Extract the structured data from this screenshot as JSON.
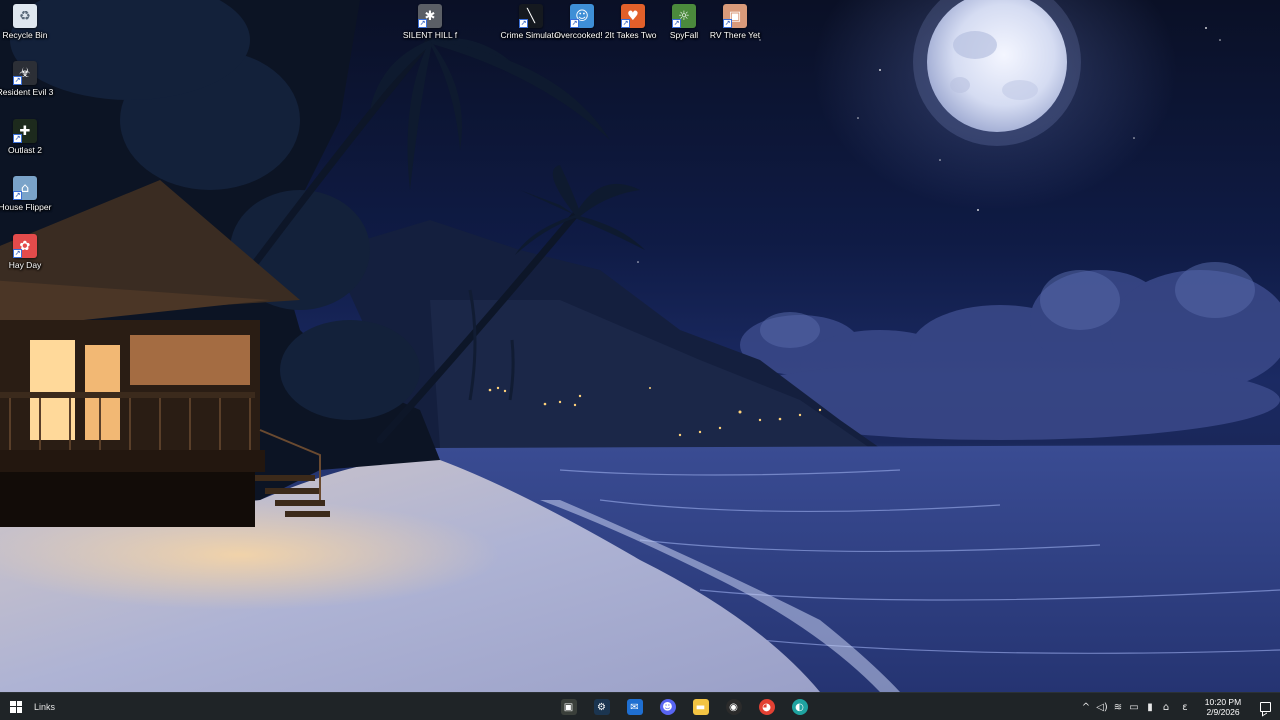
{
  "desktop": {
    "left_icons": [
      {
        "label": "Recycle Bin",
        "icon": "recycle-bin-icon",
        "color": "#dfe7ef"
      },
      {
        "label": "Resident Evil 3",
        "icon": "resident-evil-icon",
        "color": "#2c2f36"
      },
      {
        "label": "Outlast 2",
        "icon": "outlast-icon",
        "color": "#1d2a1d"
      },
      {
        "label": "House Flipper",
        "icon": "house-flipper-icon",
        "color": "#7aa3c9"
      },
      {
        "label": "Hay Day",
        "icon": "hay-day-icon",
        "color": "#e34b4b"
      }
    ],
    "top_icons": [
      {
        "label": "SILENT HILL f",
        "icon": "silent-hill-icon",
        "color": "#5b5f66"
      },
      {
        "label": "Crime Simulator",
        "icon": "crime-simulator-icon",
        "color": "#15191f"
      },
      {
        "label": "Overcooked! 2",
        "icon": "overcooked-icon",
        "color": "#3e8fd6"
      },
      {
        "label": "It Takes Two",
        "icon": "it-takes-two-icon",
        "color": "#e2602a"
      },
      {
        "label": "SpyFall",
        "icon": "spyfall-icon",
        "color": "#4b8a3c"
      },
      {
        "label": "RV There Yet",
        "icon": "rv-there-yet-icon",
        "color": "#d99a7a"
      }
    ]
  },
  "taskbar": {
    "start": "start-icon",
    "links_label": "Links",
    "pinned": [
      {
        "name": "xbox-icon",
        "color": "#3a3f3a"
      },
      {
        "name": "steam-icon",
        "color": "#1b3550"
      },
      {
        "name": "mail-icon",
        "color": "#1f6fd1"
      },
      {
        "name": "discord-icon",
        "color": "#5865f2"
      },
      {
        "name": "file-explorer-icon",
        "color": "#f3c443"
      },
      {
        "name": "obs-icon",
        "color": "#2b2b2b"
      },
      {
        "name": "chrome-icon",
        "color": "#e34133"
      },
      {
        "name": "edge-icon",
        "color": "#1fa3a0"
      }
    ],
    "tray": [
      "chevron-up-icon",
      "speaker-icon",
      "network-off-icon",
      "device-icon",
      "microphone-icon",
      "wifi-icon"
    ],
    "input_indicator": "ε",
    "time": "10:20 PM",
    "date": "2/9/2026"
  }
}
